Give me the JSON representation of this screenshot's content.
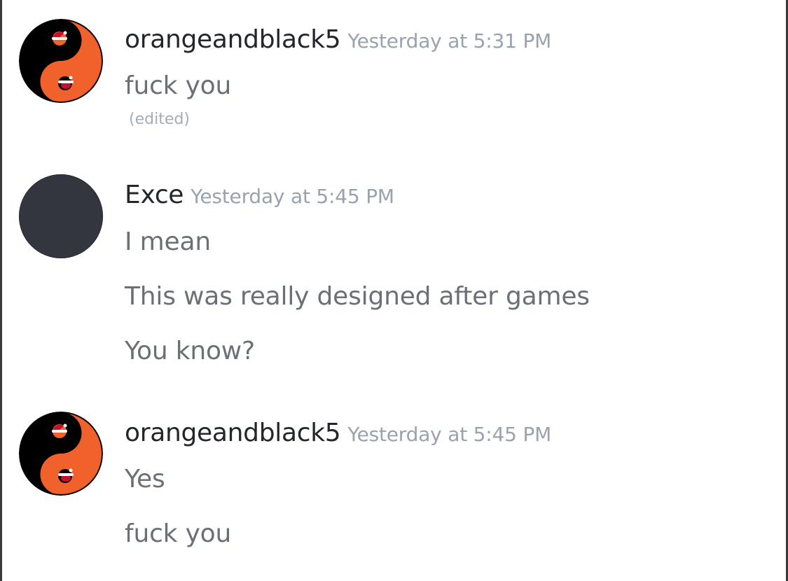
{
  "messages": [
    {
      "username": "orangeandblack5",
      "timestamp": "Yesterday at 5:31 PM",
      "avatar": "yin-yang-santa-hat-avatar",
      "lines": [
        "fuck you"
      ],
      "edited_label": "(edited)"
    },
    {
      "username": "Exce",
      "timestamp": "Yesterday at 5:45 PM",
      "avatar": "default-dark-avatar",
      "lines": [
        "I mean",
        "This was really designed after games",
        "You know?"
      ]
    },
    {
      "username": "orangeandblack5",
      "timestamp": "Yesterday at 5:45 PM",
      "avatar": "yin-yang-santa-hat-avatar",
      "lines": [
        "Yes",
        "fuck you"
      ]
    }
  ],
  "colors": {
    "username": "#23262a",
    "message_text": "#6b7077",
    "timestamp": "#99a3ad",
    "avatar_orange": "#f0612c",
    "avatar_black": "#000000",
    "avatar_dark": "#33363e"
  }
}
